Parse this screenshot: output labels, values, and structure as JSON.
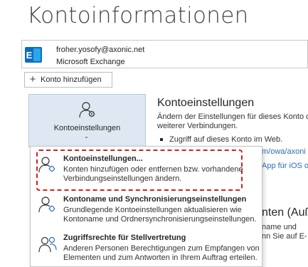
{
  "page": {
    "title": "Kontoinformationen"
  },
  "account": {
    "email": "froher.yosofy@axonic.net",
    "type": "Microsoft Exchange",
    "icon": "exchange-icon",
    "icon_color": "#0f6cbd"
  },
  "add_account": {
    "label": "Konto hinzufügen",
    "icon": "plus-icon"
  },
  "settings_tile": {
    "label": "Kontoeinstellungen",
    "icon": "user-gear-icon",
    "caret": "⌄",
    "bg_color": "#dfe8f2"
  },
  "section": {
    "title": "Kontoeinstellungen",
    "desc_line1": "Ändern der Einstellungen für dieses Konto ode",
    "desc_line2": "weiterer Verbindungen.",
    "bullet": "Zugriff auf dieses Konto im Web.",
    "link_1": "m/owa/axoni",
    "link_2": "App für iOS od"
  },
  "background_section_2": {
    "heading": "nten (Auße",
    "line1": "name und",
    "line2": "nn Sie auf E-"
  },
  "menu": {
    "items": [
      {
        "title": "Kontoeinstellungen...",
        "desc_line1": "Konten hinzufügen oder entfernen bzw. vorhandene",
        "desc_line2": "Verbindungseinstellungen ändern.",
        "icon": "user-gear-icon"
      },
      {
        "title": "Kontoname und Synchronisierungseinstellungen",
        "desc_line1": "Grundlegende Kontoeinstellungen aktualisieren wie",
        "desc_line2": "Kontoname und Ordnersynchronisierungseinstellungen.",
        "icon": "user-gear-icon"
      },
      {
        "title": "Zugriffsrechte für Stellvertretung",
        "desc_line1": "Anderen Personen Berechtigungen zum Empfangen von",
        "desc_line2": "Elementen und zum Antworten in Ihrem Auftrag erteilen.",
        "icon": "two-users-icon"
      }
    ]
  },
  "annotation": {
    "highlight_color": "#d32020"
  }
}
